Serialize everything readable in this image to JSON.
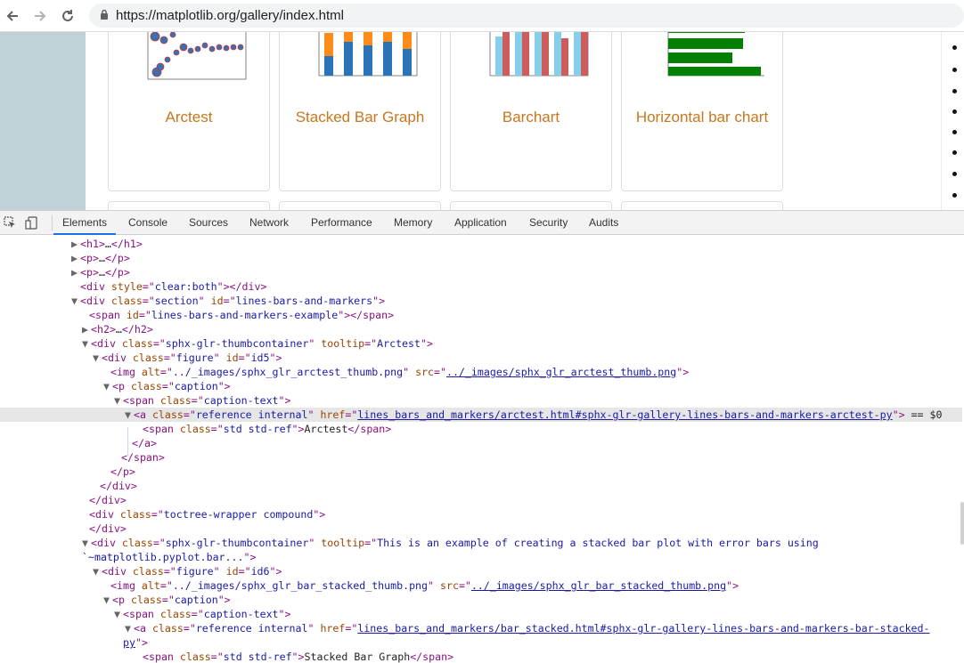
{
  "browser": {
    "url": "https://matplotlib.org/gallery/index.html",
    "icons": [
      "back-arrow-icon",
      "forward-arrow-icon",
      "reload-icon",
      "lock-icon"
    ]
  },
  "gallery": {
    "cards": [
      {
        "caption": "Arctest"
      },
      {
        "caption": "Stacked Bar Graph"
      },
      {
        "caption": "Barchart"
      },
      {
        "caption": "Horizontal bar chart"
      }
    ],
    "link_color": "#c9761d"
  },
  "devtools": {
    "tabs": [
      "Elements",
      "Console",
      "Sources",
      "Network",
      "Performance",
      "Memory",
      "Application",
      "Security",
      "Audits"
    ],
    "active_tab": "Elements",
    "lines": [
      {
        "indent": 80,
        "tri": "▶",
        "html": "<span class='t'>&lt;h1&gt;</span><span class='x'>…</span><span class='t'>&lt;/h1&gt;</span>"
      },
      {
        "indent": 80,
        "tri": "▶",
        "html": "<span class='t'>&lt;p&gt;</span><span class='x'>…</span><span class='t'>&lt;/p&gt;</span>"
      },
      {
        "indent": 80,
        "tri": "▶",
        "html": "<span class='t'>&lt;p&gt;</span><span class='x'>…</span><span class='t'>&lt;/p&gt;</span>"
      },
      {
        "indent": 90,
        "tri": "",
        "html": "<span class='t'>&lt;div </span><span class='a'>style</span><span class='t'>=\"</span><span class='v'>clear:both</span><span class='t'>\"&gt;&lt;/div&gt;</span>"
      },
      {
        "indent": 80,
        "tri": "▼",
        "html": "<span class='t'>&lt;div </span><span class='a'>class</span><span class='t'>=\"</span><span class='v'>section</span><span class='t'>\" </span><span class='a'>id</span><span class='t'>=\"</span><span class='v'>lines-bars-and-markers</span><span class='t'>\"&gt;</span>"
      },
      {
        "indent": 100,
        "tri": "",
        "html": "<span class='t'>&lt;span </span><span class='a'>id</span><span class='t'>=\"</span><span class='v'>lines-bars-and-markers-example</span><span class='t'>\"&gt;&lt;/span&gt;</span>"
      },
      {
        "indent": 92,
        "tri": "▶",
        "html": "<span class='t'>&lt;h2&gt;</span><span class='x'>…</span><span class='t'>&lt;/h2&gt;</span>"
      },
      {
        "indent": 92,
        "tri": "▼",
        "html": "<span class='t'>&lt;div </span><span class='a'>class</span><span class='t'>=\"</span><span class='v'>sphx-glr-thumbcontainer</span><span class='t'>\" </span><span class='a'>tooltip</span><span class='t'>=\"</span><span class='v'>Arctest</span><span class='t'>\"&gt;</span>"
      },
      {
        "indent": 104,
        "tri": "▼",
        "html": "<span class='t'>&lt;div </span><span class='a'>class</span><span class='t'>=\"</span><span class='v'>figure</span><span class='t'>\" </span><span class='a'>id</span><span class='t'>=\"</span><span class='v'>id5</span><span class='t'>\"&gt;</span>"
      },
      {
        "indent": 124,
        "tri": "",
        "html": "<span class='t'>&lt;img </span><span class='a'>alt</span><span class='t'>=\"</span><span class='v'>../_images/sphx_glr_arctest_thumb.png</span><span class='t'>\" </span><span class='a'>src</span><span class='t'>=\"</span><span class='u'>../_images/sphx_glr_arctest_thumb.png</span><span class='t'>\"&gt;</span>"
      },
      {
        "indent": 116,
        "tri": "▼",
        "html": "<span class='t'>&lt;p </span><span class='a'>class</span><span class='t'>=\"</span><span class='v'>caption</span><span class='t'>\"&gt;</span>"
      },
      {
        "indent": 128,
        "tri": "▼",
        "html": "<span class='t'>&lt;span </span><span class='a'>class</span><span class='t'>=\"</span><span class='v'>caption-text</span><span class='t'>\"&gt;</span>"
      },
      {
        "indent": 140,
        "tri": "▼",
        "sel": true,
        "html": "<span class='t'>&lt;a </span><span class='a'>class</span><span class='t'>=\"</span><span class='v'>reference internal</span><span class='t'>\" </span><span class='a'>href</span><span class='t'>=\"</span><span class='u'>lines_bars_and_markers/arctest.html#sphx-glr-gallery-lines-bars-and-markers-arctest-py</span><span class='t'>\"&gt;</span><span class='x'> == $0</span>"
      },
      {
        "indent": 160,
        "tri": "",
        "html": "<span class='t'>&lt;span </span><span class='a'>class</span><span class='t'>=\"</span><span class='v'>std std-ref</span><span class='t'>\"&gt;</span><span class='x'>Arctest</span><span class='t'>&lt;/span&gt;</span>"
      },
      {
        "indent": 148,
        "tri": "",
        "html": "<span class='t'>&lt;/a&gt;</span>"
      },
      {
        "indent": 136,
        "tri": "",
        "html": "<span class='t'>&lt;/span&gt;</span>"
      },
      {
        "indent": 124,
        "tri": "",
        "html": "<span class='t'>&lt;/p&gt;</span>"
      },
      {
        "indent": 112,
        "tri": "",
        "html": "<span class='t'>&lt;/div&gt;</span>"
      },
      {
        "indent": 100,
        "tri": "",
        "html": "<span class='t'>&lt;/div&gt;</span>"
      },
      {
        "indent": 100,
        "tri": "",
        "html": "<span class='t'>&lt;div </span><span class='a'>class</span><span class='t'>=\"</span><span class='v'>toctree-wrapper compound</span><span class='t'>\"&gt;</span>"
      },
      {
        "indent": 100,
        "tri": "",
        "html": "<span class='t'>&lt;/div&gt;</span>"
      },
      {
        "indent": 92,
        "tri": "▼",
        "html": "<span class='t'>&lt;div </span><span class='a'>class</span><span class='t'>=\"</span><span class='v'>sphx-glr-thumbcontainer</span><span class='t'>\" </span><span class='a'>tooltip</span><span class='t'>=\"</span><span class='v'>This is an example of creating a stacked bar plot with error bars using</span>"
      },
      {
        "indent": 92,
        "tri": "",
        "html": "<span class='v'>`~matplotlib.pyplot.bar...</span><span class='t'>\"&gt;</span>"
      },
      {
        "indent": 104,
        "tri": "▼",
        "html": "<span class='t'>&lt;div </span><span class='a'>class</span><span class='t'>=\"</span><span class='v'>figure</span><span class='t'>\" </span><span class='a'>id</span><span class='t'>=\"</span><span class='v'>id6</span><span class='t'>\"&gt;</span>"
      },
      {
        "indent": 124,
        "tri": "",
        "html": "<span class='t'>&lt;img </span><span class='a'>alt</span><span class='t'>=\"</span><span class='v'>../_images/sphx_glr_bar_stacked_thumb.png</span><span class='t'>\" </span><span class='a'>src</span><span class='t'>=\"</span><span class='u'>../_images/sphx_glr_bar_stacked_thumb.png</span><span class='t'>\"&gt;</span>"
      },
      {
        "indent": 116,
        "tri": "▼",
        "html": "<span class='t'>&lt;p </span><span class='a'>class</span><span class='t'>=\"</span><span class='v'>caption</span><span class='t'>\"&gt;</span>"
      },
      {
        "indent": 128,
        "tri": "▼",
        "html": "<span class='t'>&lt;span </span><span class='a'>class</span><span class='t'>=\"</span><span class='v'>caption-text</span><span class='t'>\"&gt;</span>"
      },
      {
        "indent": 140,
        "tri": "▼",
        "html": "<span class='t'>&lt;a </span><span class='a'>class</span><span class='t'>=\"</span><span class='v'>reference internal</span><span class='t'>\" </span><span class='a'>href</span><span class='t'>=\"</span><span class='u'>lines_bars_and_markers/bar_stacked.html#sphx-glr-gallery-lines-bars-and-markers-bar-stacked-</span>"
      },
      {
        "indent": 138,
        "tri": "",
        "html": "<span class='u'>py</span><span class='t'>\"&gt;</span>"
      },
      {
        "indent": 160,
        "tri": "",
        "html": "<span class='t'>&lt;span </span><span class='a'>class</span><span class='t'>=\"</span><span class='v'>std std-ref</span><span class='t'>\"&gt;</span><span class='x'>Stacked Bar Graph</span><span class='t'>&lt;/span&gt;</span>"
      }
    ]
  }
}
